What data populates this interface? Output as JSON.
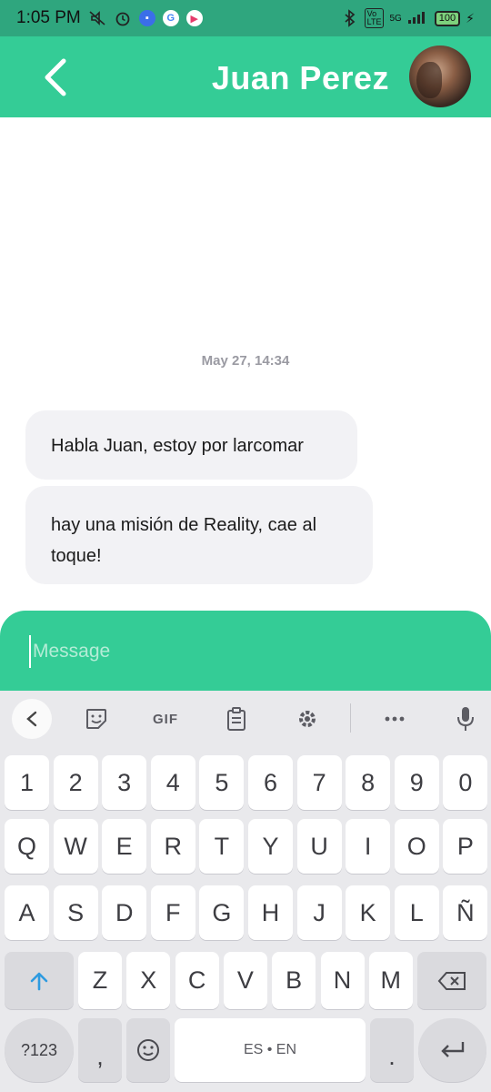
{
  "status_bar": {
    "time": "1:05 PM",
    "battery": "100",
    "network": "5G"
  },
  "header": {
    "contact_name": "Juan Perez"
  },
  "conversation": {
    "timestamp": "May 27, 14:34",
    "messages": [
      {
        "text": "Habla Juan, estoy por larcomar"
      },
      {
        "text": "hay una misión de Reality, cae al toque!"
      }
    ]
  },
  "composer": {
    "placeholder": "Message",
    "value": ""
  },
  "keyboard": {
    "toolbar": {
      "gif_label": "GIF"
    },
    "row_numbers": [
      "1",
      "2",
      "3",
      "4",
      "5",
      "6",
      "7",
      "8",
      "9",
      "0"
    ],
    "row_1": [
      "Q",
      "W",
      "E",
      "R",
      "T",
      "Y",
      "U",
      "I",
      "O",
      "P"
    ],
    "row_2": [
      "A",
      "S",
      "D",
      "F",
      "G",
      "H",
      "J",
      "K",
      "L",
      "Ñ"
    ],
    "row_3": [
      "Z",
      "X",
      "C",
      "V",
      "B",
      "N",
      "M"
    ],
    "symbols_label": "?123",
    "comma_label": ",",
    "space_label": "ES • EN",
    "period_label": "."
  },
  "colors": {
    "accent": "#34cc96",
    "status_bar": "#2fa67e",
    "bubble": "#f2f2f5"
  }
}
